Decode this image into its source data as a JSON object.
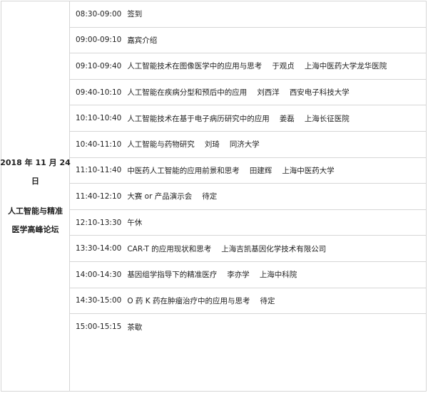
{
  "date_column": {
    "date_line1": "2018 年 11 月 24",
    "date_line2": "日",
    "forum_line1": "人工智能与精准",
    "forum_line2": "医学高峰论坛"
  },
  "sessions": [
    {
      "time": "08:30-09:00",
      "title": "签到",
      "speaker": "",
      "affiliation": ""
    },
    {
      "time": "09:00-09:10",
      "title": "嘉宾介绍",
      "speaker": "",
      "affiliation": ""
    },
    {
      "time": "09:10-09:40",
      "title": "人工智能技术在图像医学中的应用与思考",
      "speaker": "于观贞",
      "affiliation": "上海中医药大学龙华医院"
    },
    {
      "time": "09:40-10:10",
      "title": "人工智能在疾病分型和预后中的应用",
      "speaker": "刘西洋",
      "affiliation": "西安电子科技大学"
    },
    {
      "time": "10:10-10:40",
      "title": "人工智能技术在基于电子病历研究中的应用",
      "speaker": "姜磊",
      "affiliation": "上海长征医院"
    },
    {
      "time": "10:40-11:10",
      "title": "人工智能与药物研究",
      "speaker": "刘琦",
      "affiliation": "同济大学"
    },
    {
      "time": "11:10-11:40",
      "title": "中医药人工智能的应用前景和思考",
      "speaker": "田建辉",
      "affiliation": "上海中医药大学"
    },
    {
      "time": "11:40-12:10",
      "title": "大赛 or 产品演示会",
      "speaker": "待定",
      "affiliation": ""
    },
    {
      "time": "12:10-13:30",
      "title": "午休",
      "speaker": "",
      "affiliation": ""
    },
    {
      "time": "13:30-14:00",
      "title": "CAR-T 的应用现状和思考",
      "speaker": "上海吉凯基因化学技术有限公司",
      "affiliation": ""
    },
    {
      "time": "14:00-14:30",
      "title": "基因组学指导下的精准医疗",
      "speaker": "李亦学",
      "affiliation": "上海中科院"
    },
    {
      "time": "14:30-15:00",
      "title": "O 药 K 药在肿瘤治疗中的应用与思考",
      "speaker": "待定",
      "affiliation": ""
    },
    {
      "time": "15:00-15:15",
      "title": "茶歇",
      "speaker": "",
      "affiliation": ""
    }
  ]
}
